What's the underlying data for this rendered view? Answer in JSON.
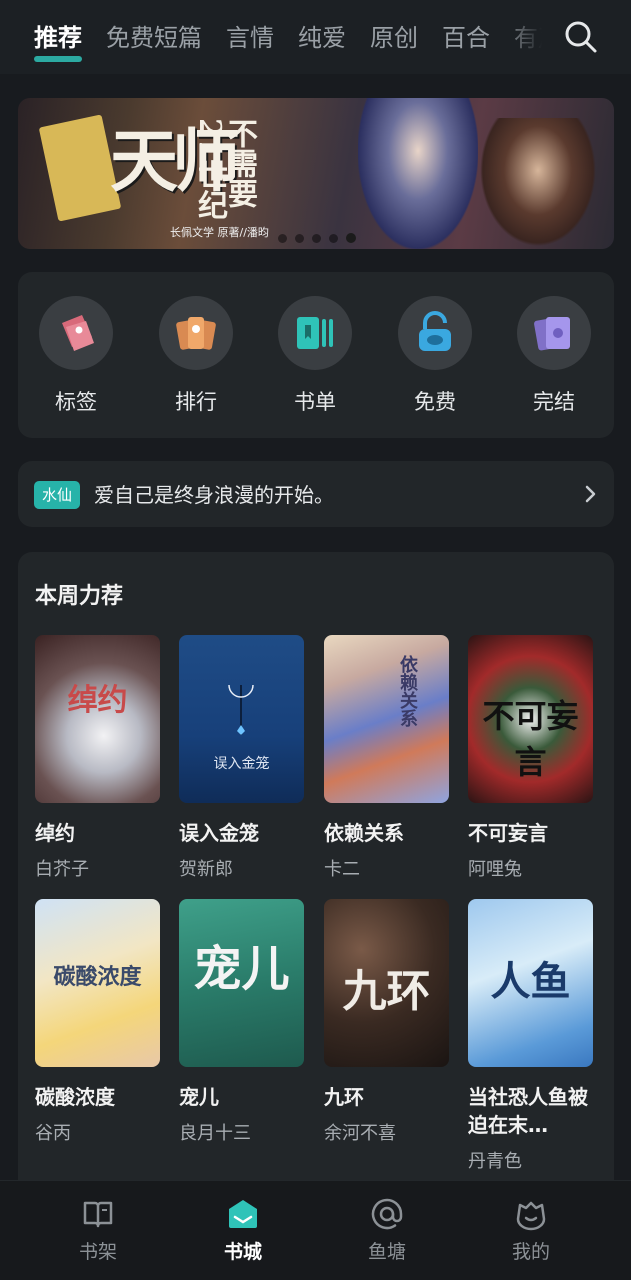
{
  "top_tabs": [
    "推荐",
    "免费短篇",
    "言情",
    "纯爱",
    "原创",
    "百合",
    "有声"
  ],
  "banner": {
    "title": "天师",
    "subtitle": "不需要21世纪",
    "credit": "长佩文学   原著//潘昀"
  },
  "categories": [
    {
      "label": "标签",
      "icon": "tag-icon"
    },
    {
      "label": "排行",
      "icon": "ranking-icon"
    },
    {
      "label": "书单",
      "icon": "booklist-icon"
    },
    {
      "label": "免费",
      "icon": "free-lock-icon"
    },
    {
      "label": "完结",
      "icon": "finished-cards-icon"
    }
  ],
  "notice": {
    "tag": "水仙",
    "text": "爱自己是终身浪漫的开始。"
  },
  "weekly": {
    "title": "本周力荐",
    "books": [
      {
        "name": "绰约",
        "author": "白芥子",
        "cover_text": "绰约"
      },
      {
        "name": "误入金笼",
        "author": "贺新郎",
        "cover_text": "误入金笼"
      },
      {
        "name": "依赖关系",
        "author": "卡二",
        "cover_text": "依赖关系"
      },
      {
        "name": "不可妄言",
        "author": "阿哩兔",
        "cover_text": "不可妄言"
      },
      {
        "name": "碳酸浓度",
        "author": "谷丙",
        "cover_text": "碳酸浓度"
      },
      {
        "name": "宠儿",
        "author": "良月十三",
        "cover_text": "宠儿"
      },
      {
        "name": "九环",
        "author": "余河不喜",
        "cover_text": "九环"
      },
      {
        "name": "当社恐人鱼被迫在末…",
        "author": "丹青色",
        "cover_text": "人鱼"
      }
    ]
  },
  "bottom_nav": [
    {
      "label": "书架",
      "icon": "bookshelf-icon"
    },
    {
      "label": "书城",
      "icon": "bookstore-icon"
    },
    {
      "label": "鱼塘",
      "icon": "at-pond-icon"
    },
    {
      "label": "我的",
      "icon": "profile-icon"
    }
  ]
}
